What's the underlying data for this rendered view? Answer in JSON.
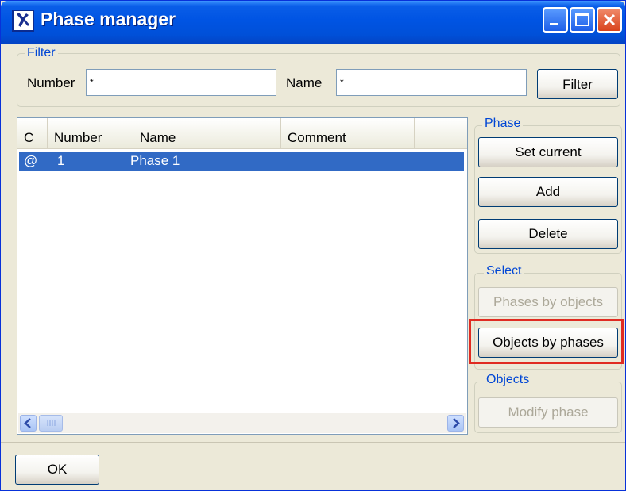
{
  "window": {
    "title": "Phase manager"
  },
  "filter": {
    "legend": "Filter",
    "number_label": "Number",
    "number_value": "*",
    "name_label": "Name",
    "name_value": "*",
    "filter_button": "Filter"
  },
  "list": {
    "columns": [
      "C",
      "Number",
      "Name",
      "Comment"
    ],
    "rows": [
      {
        "c": "@",
        "number": "1",
        "name": "Phase 1",
        "comment": ""
      }
    ]
  },
  "phase_group": {
    "legend": "Phase",
    "set_current": "Set current",
    "add": "Add",
    "delete": "Delete"
  },
  "select_group": {
    "legend": "Select",
    "phases_by_objects": "Phases by objects",
    "objects_by_phases": "Objects by phases"
  },
  "objects_group": {
    "legend": "Objects",
    "modify_phase": "Modify phase"
  },
  "footer": {
    "ok": "OK"
  },
  "colors": {
    "accent": "#0054e3",
    "selection": "#316ac5",
    "highlight": "#e02b22",
    "group_legend": "#0046d5"
  }
}
